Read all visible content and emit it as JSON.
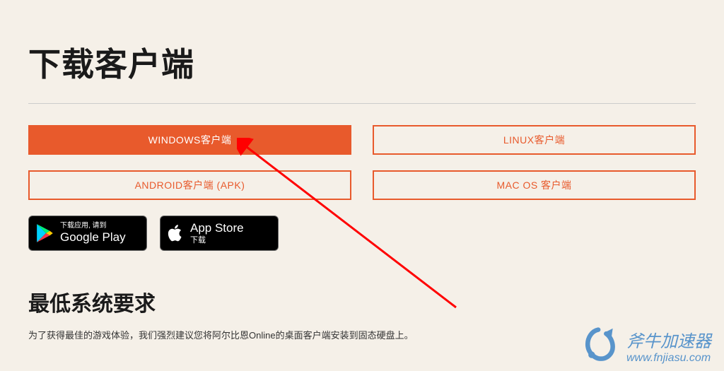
{
  "page": {
    "title": "下载客户端"
  },
  "buttons": {
    "windows": "WINDOWS客户端",
    "linux": "LINUX客户端",
    "android": "ANDROID客户端 (APK)",
    "macos": "MAC OS 客户端"
  },
  "stores": {
    "google": {
      "top": "下载应用, 请到",
      "bottom": "Google Play"
    },
    "apple": {
      "top": "App Store",
      "bottom": "下载"
    }
  },
  "sysreq": {
    "title": "最低系统要求",
    "note": "为了获得最佳的游戏体验，我们强烈建议您将阿尔比恩Online的桌面客户端安装到固态硬盘上。"
  },
  "watermark": {
    "title": "斧牛加速器",
    "url": "www.fnjiasu.com"
  }
}
